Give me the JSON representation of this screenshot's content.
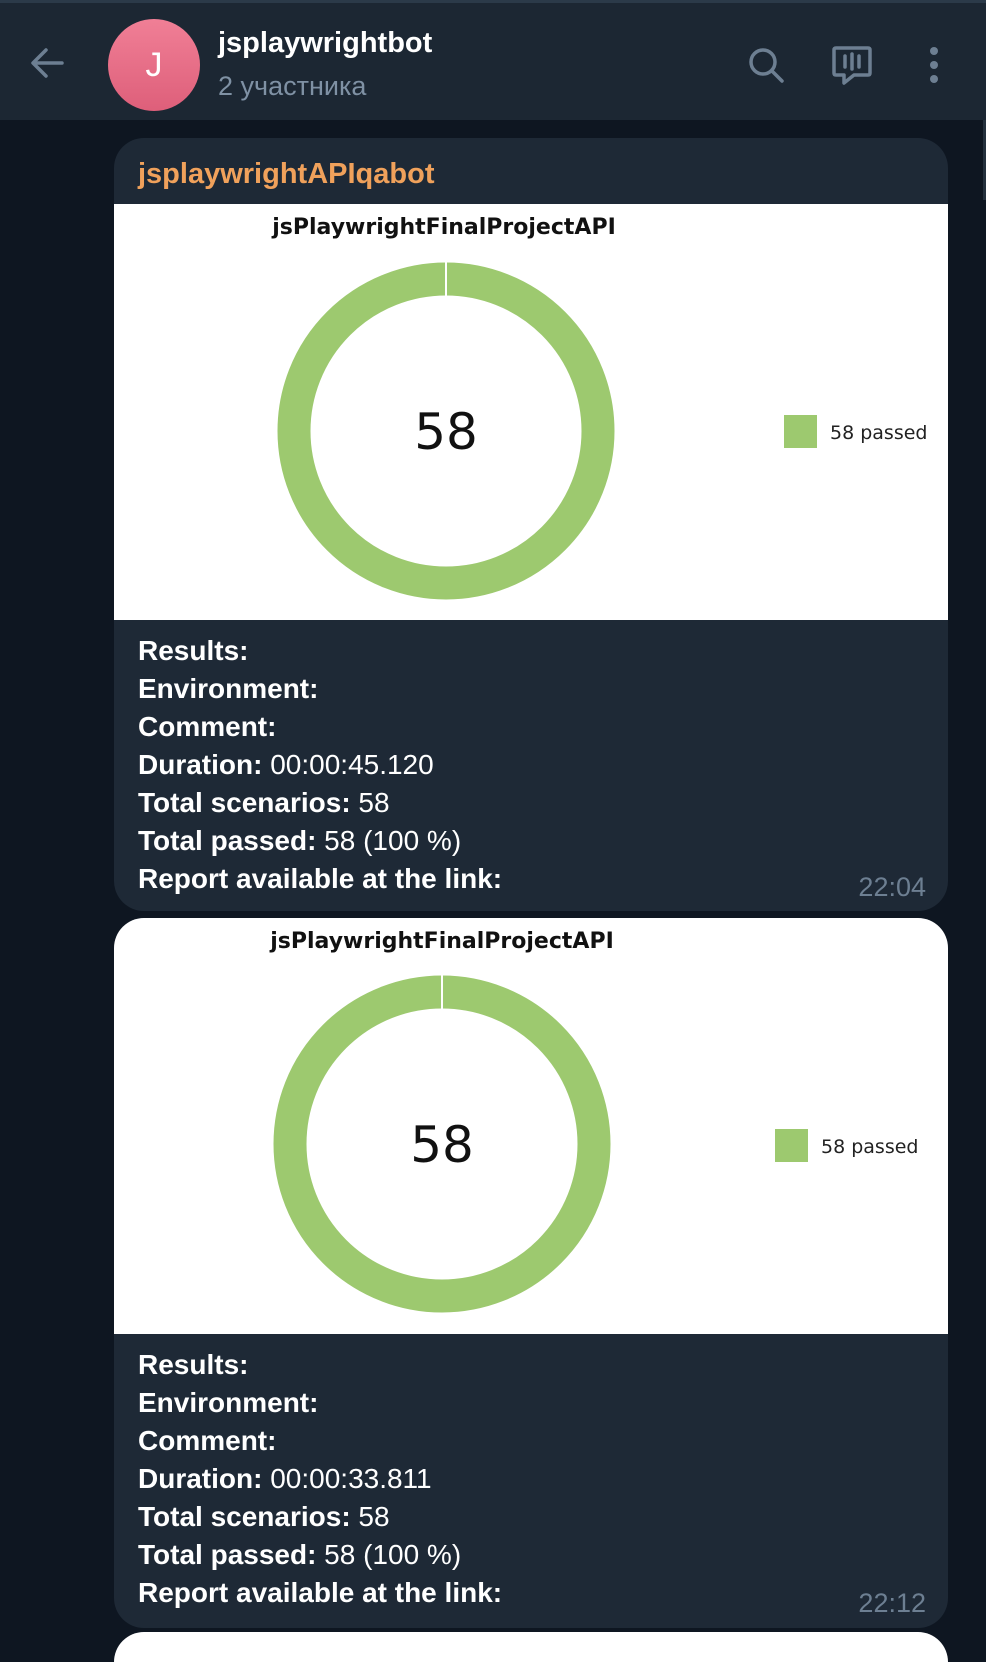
{
  "header": {
    "avatar_letter": "J",
    "title": "jsplaywrightbot",
    "subtitle": "2 участника",
    "icons": [
      "back-arrow-icon",
      "search-icon",
      "voice-chat-icon",
      "more-vertical-icon"
    ]
  },
  "messages": [
    {
      "sender": "jsplaywrightAPIqabot",
      "time": "22:04",
      "chart_title": "jsPlaywrightFinalProjectAPI",
      "center_value": "58",
      "legend": "58 passed",
      "lines": [
        {
          "label": "Results:",
          "value": ""
        },
        {
          "label": "Environment:",
          "value": ""
        },
        {
          "label": "Comment:",
          "value": ""
        },
        {
          "label": "Duration:",
          "value": " 00:00:45.120"
        },
        {
          "label": "Total scenarios:",
          "value": " 58"
        },
        {
          "label": "Total passed:",
          "value": " 58 (100 %)"
        },
        {
          "label": "Report available at the link:",
          "value": ""
        }
      ]
    },
    {
      "sender": "",
      "time": "22:12",
      "chart_title": "jsPlaywrightFinalProjectAPI",
      "center_value": "58",
      "legend": "58 passed",
      "lines": [
        {
          "label": "Results:",
          "value": ""
        },
        {
          "label": "Environment:",
          "value": ""
        },
        {
          "label": "Comment:",
          "value": ""
        },
        {
          "label": "Duration:",
          "value": " 00:00:33.811"
        },
        {
          "label": "Total scenarios:",
          "value": " 58"
        },
        {
          "label": "Total passed:",
          "value": " 58 (100 %)"
        },
        {
          "label": "Report available at the link:",
          "value": ""
        }
      ]
    }
  ],
  "chart_data": [
    {
      "type": "pie",
      "title": "jsPlaywrightFinalProjectAPI",
      "categories": [
        "passed"
      ],
      "values": [
        58
      ],
      "legend": "58 passed",
      "color": "#9dc96f",
      "legend_position": "right"
    },
    {
      "type": "pie",
      "title": "jsPlaywrightFinalProjectAPI",
      "categories": [
        "passed"
      ],
      "values": [
        58
      ],
      "legend": "58 passed",
      "color": "#9dc96f",
      "legend_position": "right"
    }
  ],
  "colors": {
    "background": "#0e1621",
    "header": "#1c2733",
    "bubble": "#1e2936",
    "sender": "#f0a15b",
    "passed": "#9dc96f",
    "avatar": "#e26a84"
  }
}
